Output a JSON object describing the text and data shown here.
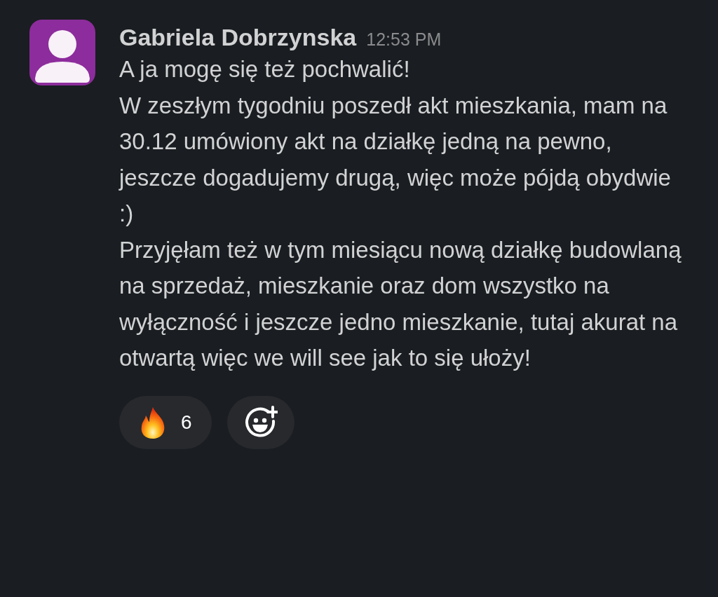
{
  "message": {
    "author": "Gabriela Dobrzynska",
    "time": "12:53 PM",
    "paragraphs": [
      "A ja mogę się też pochwalić!",
      "W zeszłym tygodniu poszedł akt mieszkania, mam na 30.12 umówiony akt na działkę jedną na pewno, jeszcze dogadujemy drugą, więc może pójdą obydwie :)",
      "Przyjęłam też w tym miesiącu nową działkę budowlaną na sprzedaż, mieszkanie oraz dom wszystko na wyłączność i jeszcze jedno mieszkanie, tutaj akurat na otwartą więc we will see jak to się ułoży!"
    ],
    "reactions": [
      {
        "kind": "fire",
        "count": "6"
      }
    ]
  }
}
